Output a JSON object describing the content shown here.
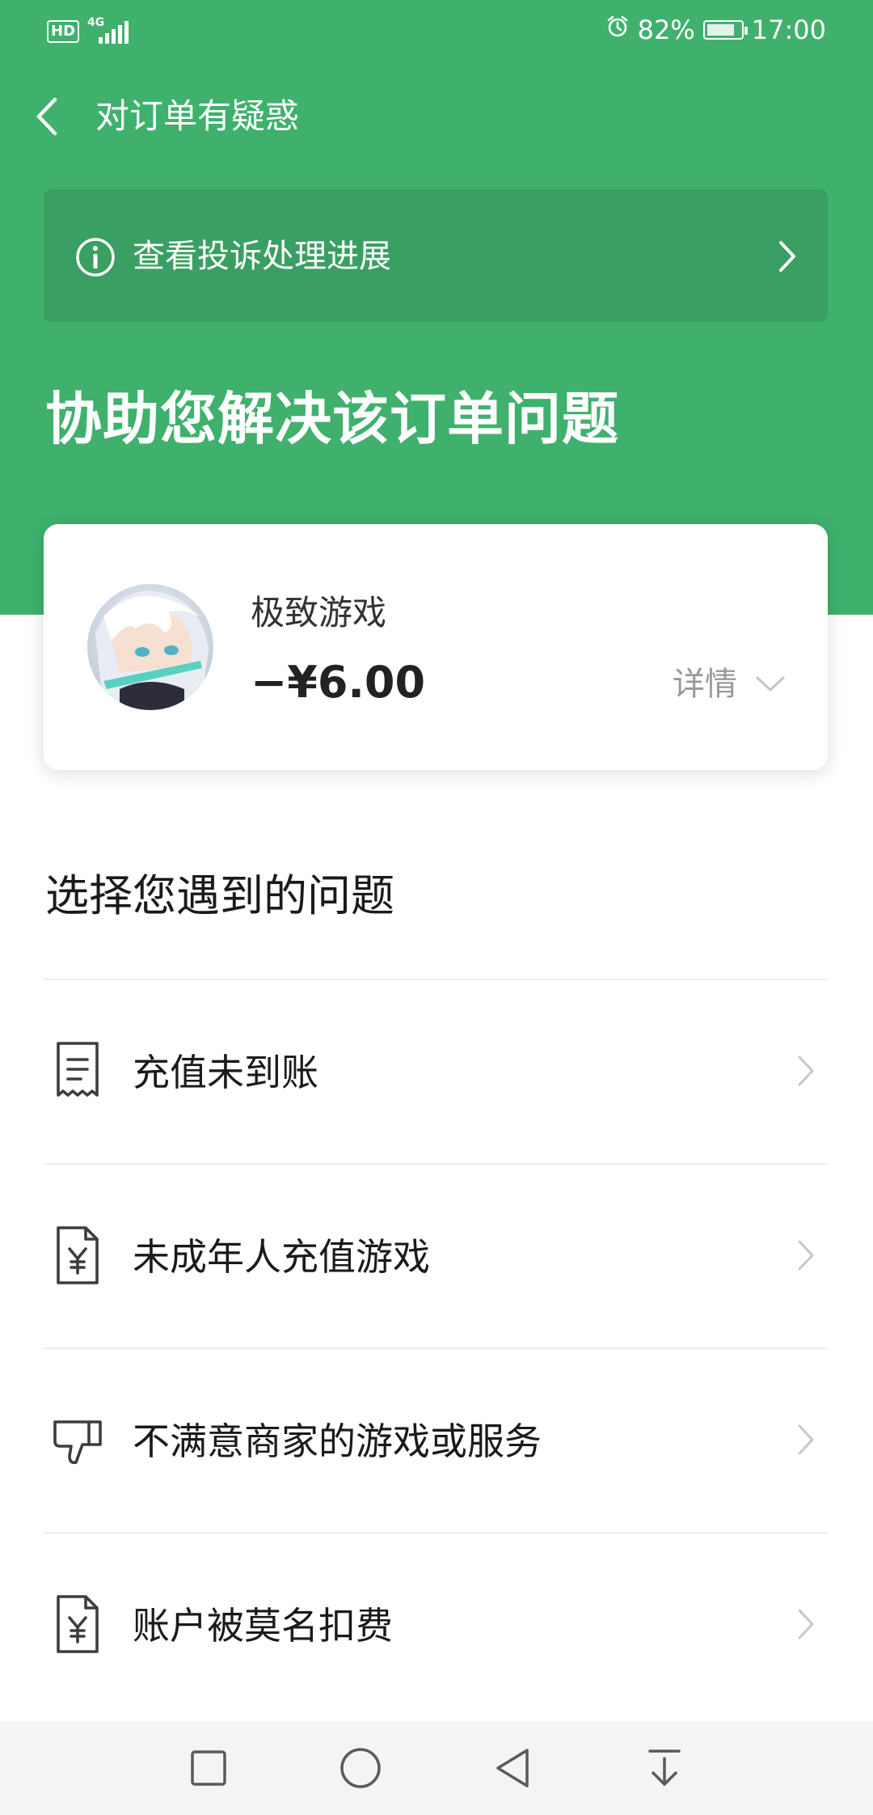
{
  "status_bar": {
    "hd": "HD",
    "network": "4G",
    "battery_percent": "82%",
    "battery_level": 0.82,
    "time": "17:00"
  },
  "header": {
    "title": "对订单有疑惑"
  },
  "complaint_banner": {
    "label": "查看投诉处理进展"
  },
  "hero": {
    "title": "协助您解决该订单问题"
  },
  "order": {
    "merchant": "极致游戏",
    "amount": "−¥6.00",
    "details_label": "详情"
  },
  "problems": {
    "title": "选择您遇到的问题",
    "items": [
      {
        "label": "充值未到账",
        "icon": "receipt-icon"
      },
      {
        "label": "未成年人充值游戏",
        "icon": "yen-document-icon"
      },
      {
        "label": "不满意商家的游戏或服务",
        "icon": "thumbs-down-icon"
      },
      {
        "label": "账户被莫名扣费",
        "icon": "yen-document-icon"
      }
    ]
  },
  "colors": {
    "brand_green": "#3fb16d",
    "banner_green": "#3a9f62"
  },
  "nav": {
    "buttons": [
      "recents-button",
      "home-button",
      "back-button",
      "notification-button"
    ]
  }
}
